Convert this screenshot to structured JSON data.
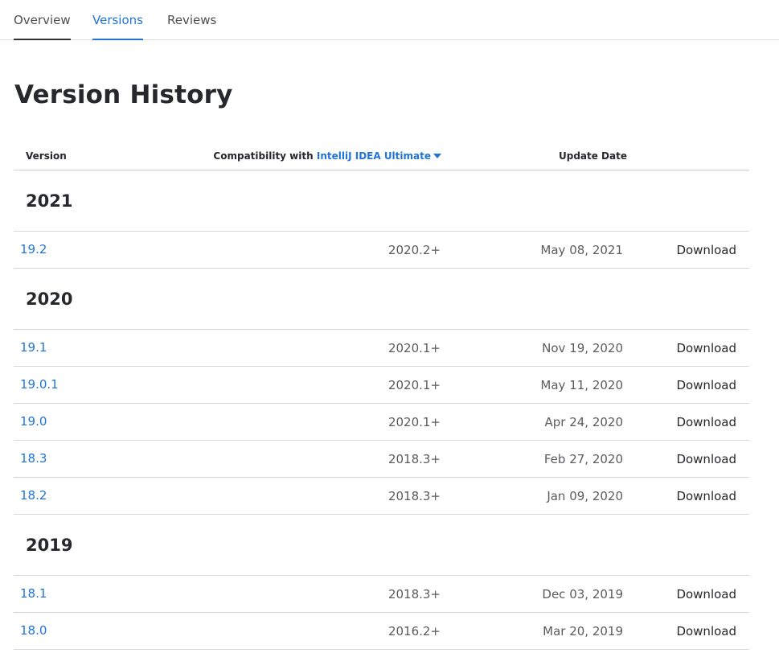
{
  "tabs": [
    {
      "label": "Overview"
    },
    {
      "label": "Versions"
    },
    {
      "label": "Reviews"
    }
  ],
  "page_title": "Version History",
  "table_header": {
    "version": "Version",
    "compat_prefix": "Compatibility with",
    "compat_product": "IntelliJ IDEA Ultimate",
    "update_date": "Update Date"
  },
  "groups": [
    {
      "year": "2021",
      "rows": [
        {
          "version": "19.2",
          "compat": "2020.2+",
          "date": "May 08, 2021",
          "action": "Download"
        }
      ]
    },
    {
      "year": "2020",
      "rows": [
        {
          "version": "19.1",
          "compat": "2020.1+",
          "date": "Nov 19, 2020",
          "action": "Download"
        },
        {
          "version": "19.0.1",
          "compat": "2020.1+",
          "date": "May 11, 2020",
          "action": "Download"
        },
        {
          "version": "19.0",
          "compat": "2020.1+",
          "date": "Apr 24, 2020",
          "action": "Download"
        },
        {
          "version": "18.3",
          "compat": "2018.3+",
          "date": "Feb 27, 2020",
          "action": "Download"
        },
        {
          "version": "18.2",
          "compat": "2018.3+",
          "date": "Jan 09, 2020",
          "action": "Download"
        }
      ]
    },
    {
      "year": "2019",
      "rows": [
        {
          "version": "18.1",
          "compat": "2018.3+",
          "date": "Dec 03, 2019",
          "action": "Download"
        },
        {
          "version": "18.0",
          "compat": "2016.2+",
          "date": "Mar 20, 2019",
          "action": "Download"
        }
      ]
    }
  ]
}
